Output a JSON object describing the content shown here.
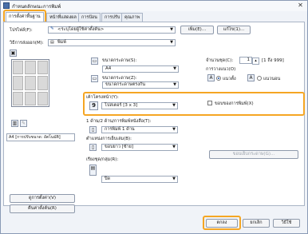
{
  "window": {
    "title": "กำหนดลักษณะการพิมพ์",
    "close": "✕"
  },
  "tabs": [
    {
      "label": "การตั้งค่าพื้นฐาน"
    },
    {
      "label": "หน้าที่แสดงผล"
    },
    {
      "label": "การป้อน"
    },
    {
      "label": "การปรับ"
    },
    {
      "label": "คุณภาพ"
    }
  ],
  "profile": {
    "label": "โปรไฟล์(F):",
    "value": "<ระบุโดยผู้ใช้ค่าตั้งต้น>",
    "edit_button": "แก้ไข(1)...",
    "add_button": "เพิ่ม(E)..."
  },
  "output_method": {
    "label": "วิธีการส่งออก(M):",
    "value": "พิมพ์"
  },
  "page_size": {
    "label": "ขนาดกระดาษ(S):",
    "value": "A4"
  },
  "output_size": {
    "label": "ขนาดกระดาษ(Z):",
    "value": "ขนาดกระดาษตรงกัน"
  },
  "copies": {
    "label": "จำนวนชุด(C):",
    "value": "1",
    "range": "[1 ถึง 999]"
  },
  "orientation": {
    "label": "การวางแนว(O)",
    "portrait": "แนวตั้ง",
    "landscape": "แนวนอน"
  },
  "page_layout": {
    "label": "เค้าโครงหน้า(Y):",
    "value": "โปสเตอร์ [3 x 3]",
    "badge": "9"
  },
  "poster_border": {
    "label": "ขอบของการพิมพ์(X)"
  },
  "print_style": {
    "label": "1 ด้าน/2 ด้าน/การพิมพ์หนังสือ(T):",
    "value": "การพิมพ์ 1 ด้าน"
  },
  "binding": {
    "label": "ตำแหน่งการเย็บเล่ม(B):",
    "value": "ขอบยาว [ซ้าย]",
    "button": "ขอบเย็บกระดาษ(G)..."
  },
  "finishing": {
    "label": "เรียงชุด/กลุ่ม(R):",
    "value": "ปิด"
  },
  "left_panel": {
    "status": "A4 [การปรับขนาด: อัตโนมัติ]",
    "view_settings": "ดูการตั้งค่า(V)",
    "restore_defaults": "คืนค่าตั้งต้น(R)"
  },
  "footer": {
    "ok": "ตกลง",
    "cancel": "ยกเลิก",
    "help": "วิธีใช้"
  },
  "colors": {
    "highlight": "#f5a623",
    "accent": "#2455a4"
  }
}
